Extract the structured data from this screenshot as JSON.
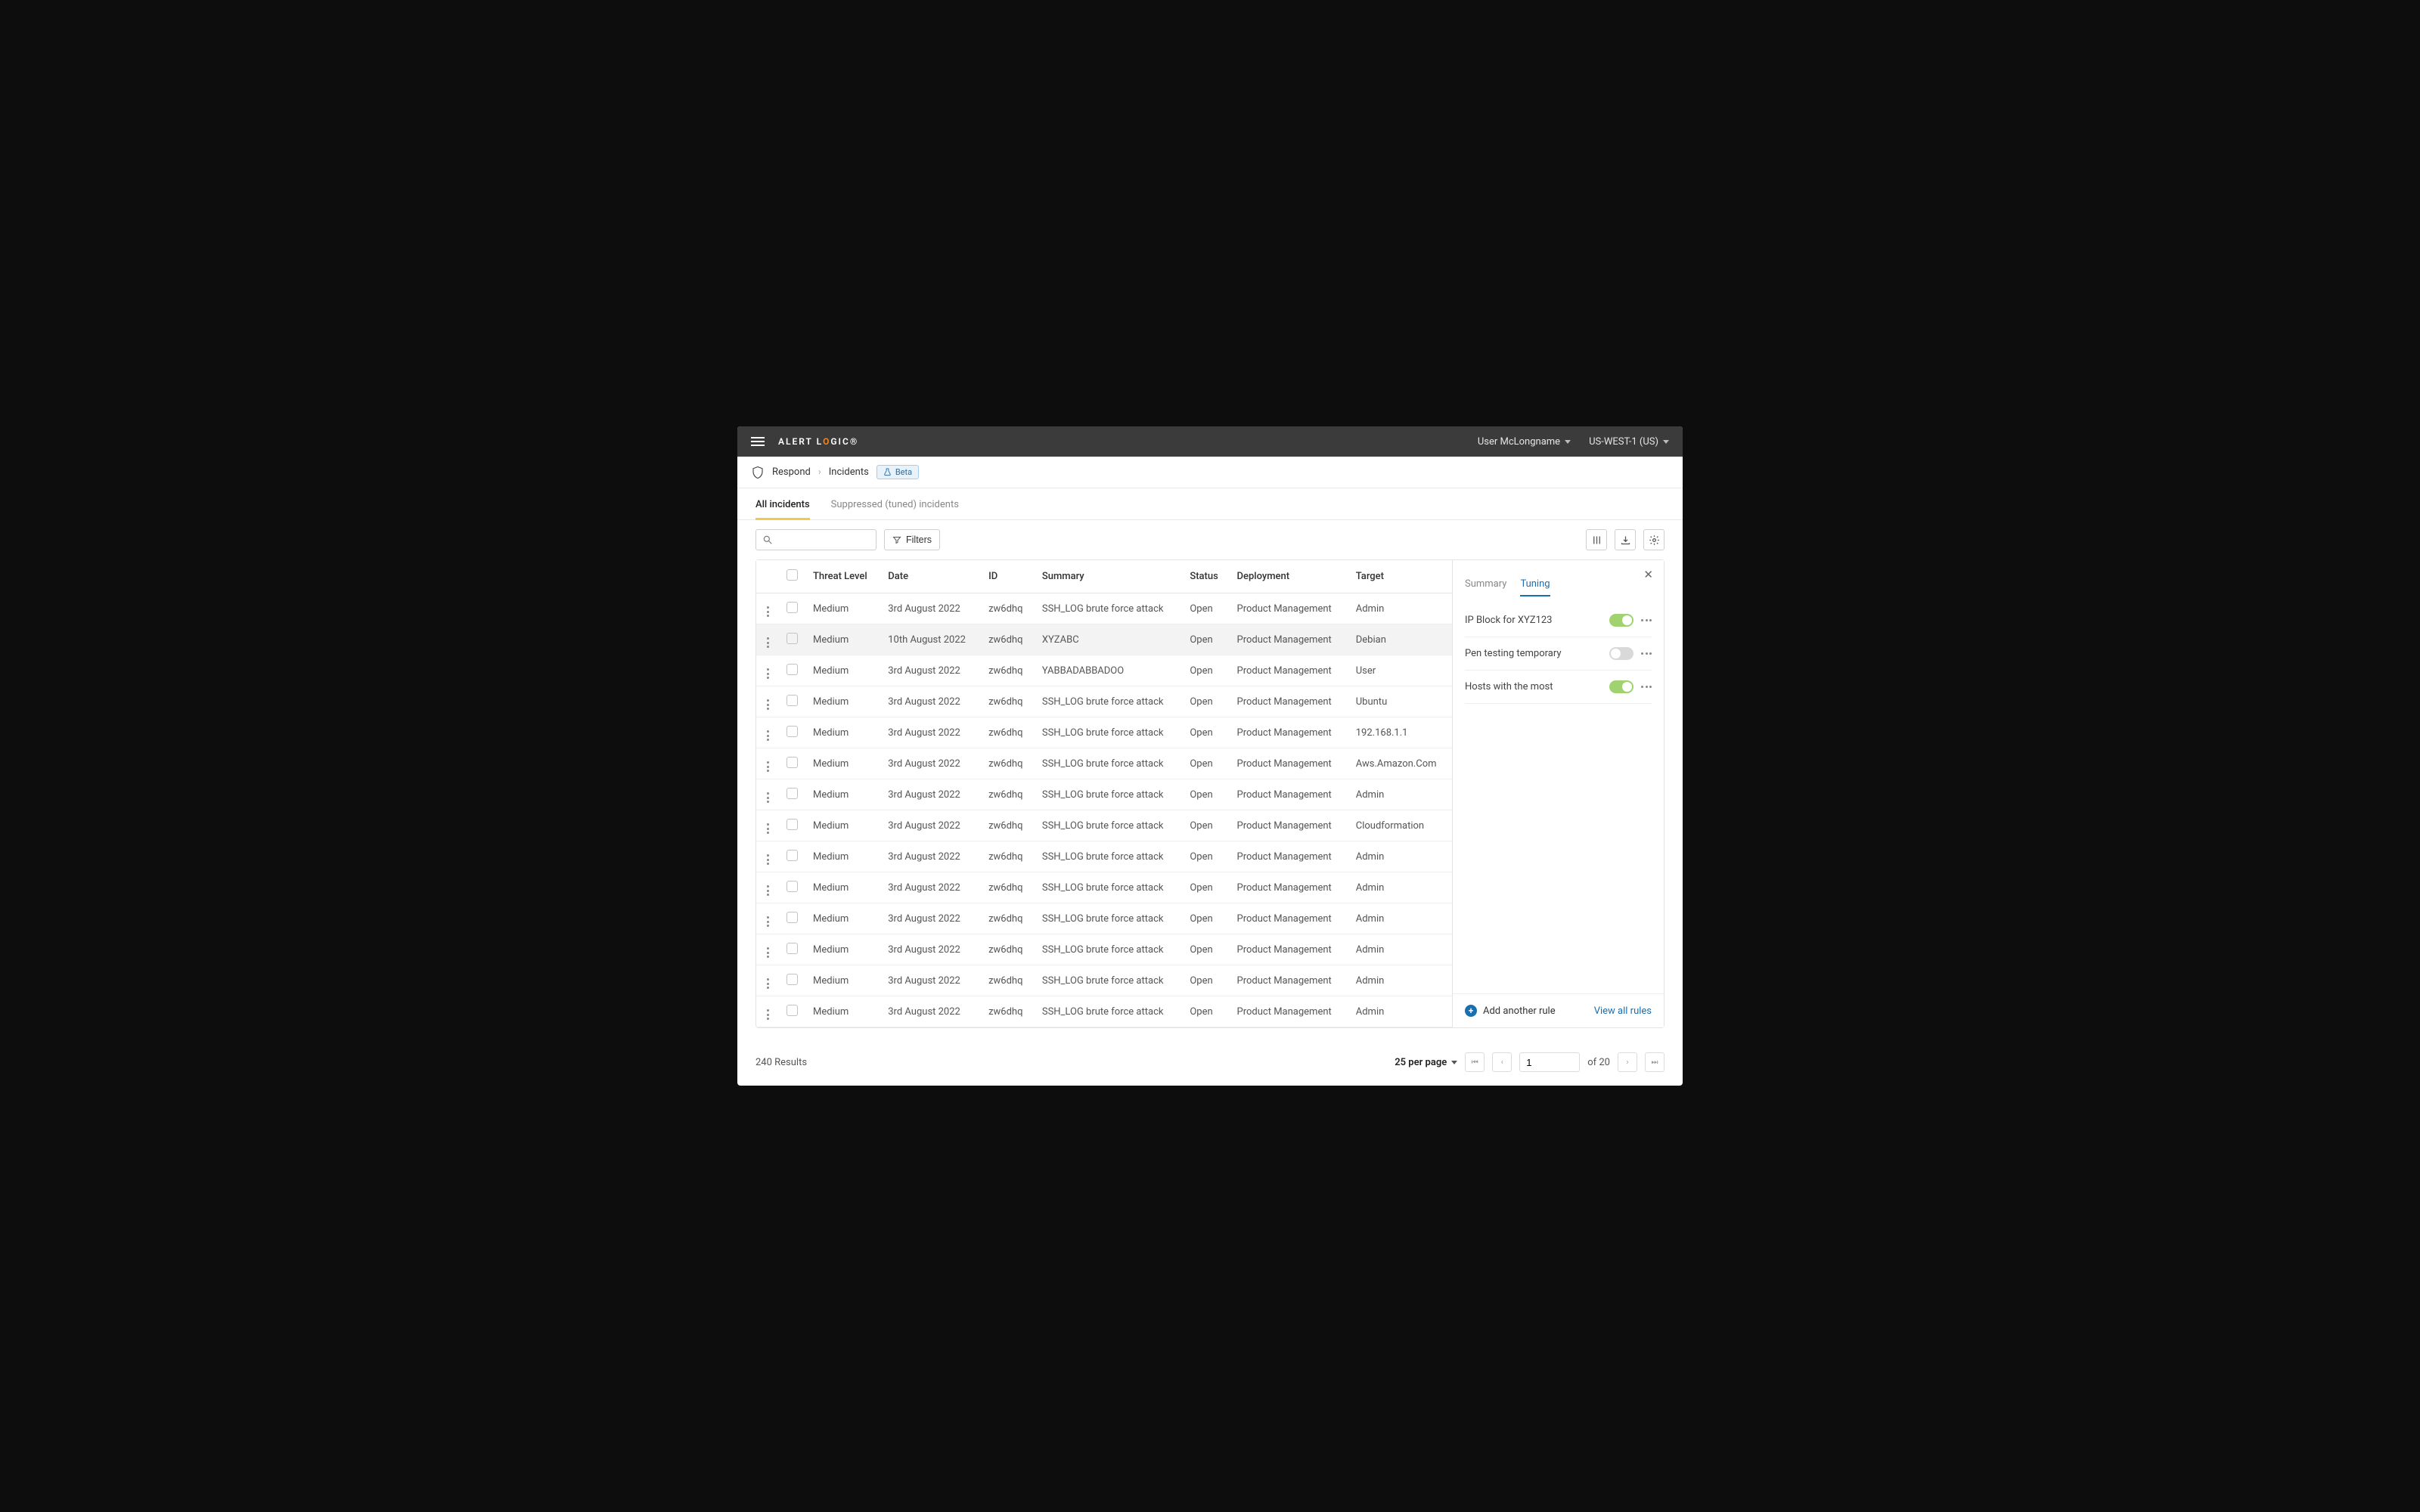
{
  "topbar": {
    "brand_prefix": "ALERT L",
    "brand_o": "O",
    "brand_suffix": "GIC®",
    "user_label": "User McLongname",
    "region_label": "US-WEST-1 (US)"
  },
  "breadcrumb": {
    "respond": "Respond",
    "incidents": "Incidents",
    "beta_label": "Beta"
  },
  "tabs": {
    "all": "All incidents",
    "suppressed": "Suppressed (tuned) incidents"
  },
  "toolbar": {
    "filters_label": "Filters"
  },
  "columns": {
    "threat": "Threat Level",
    "date": "Date",
    "id": "ID",
    "summary": "Summary",
    "status": "Status",
    "deployment": "Deployment",
    "target": "Target"
  },
  "rows": [
    {
      "threat": "Medium",
      "date": "3rd August 2022",
      "id": "zw6dhq",
      "summary": "SSH_LOG brute force attack",
      "status": "Open",
      "deployment": "Product Management",
      "target": "Admin",
      "selected": false
    },
    {
      "threat": "Medium",
      "date": "10th August 2022",
      "id": "zw6dhq",
      "summary": "XYZABC",
      "status": "Open",
      "deployment": "Product Management",
      "target": "Debian",
      "selected": true
    },
    {
      "threat": "Medium",
      "date": "3rd August 2022",
      "id": "zw6dhq",
      "summary": "YABBADABBADOO",
      "status": "Open",
      "deployment": "Product Management",
      "target": "User",
      "selected": false
    },
    {
      "threat": "Medium",
      "date": "3rd August 2022",
      "id": "zw6dhq",
      "summary": "SSH_LOG brute force attack",
      "status": "Open",
      "deployment": "Product Management",
      "target": "Ubuntu",
      "selected": false
    },
    {
      "threat": "Medium",
      "date": "3rd August 2022",
      "id": "zw6dhq",
      "summary": "SSH_LOG brute force attack",
      "status": "Open",
      "deployment": "Product Management",
      "target": "192.168.1.1",
      "selected": false
    },
    {
      "threat": "Medium",
      "date": "3rd August 2022",
      "id": "zw6dhq",
      "summary": "SSH_LOG brute force attack",
      "status": "Open",
      "deployment": "Product Management",
      "target": "Aws.Amazon.Com",
      "selected": false
    },
    {
      "threat": "Medium",
      "date": "3rd August 2022",
      "id": "zw6dhq",
      "summary": "SSH_LOG brute force attack",
      "status": "Open",
      "deployment": "Product Management",
      "target": "Admin",
      "selected": false
    },
    {
      "threat": "Medium",
      "date": "3rd August 2022",
      "id": "zw6dhq",
      "summary": "SSH_LOG brute force attack",
      "status": "Open",
      "deployment": "Product Management",
      "target": "Cloudformation",
      "selected": false
    },
    {
      "threat": "Medium",
      "date": "3rd August 2022",
      "id": "zw6dhq",
      "summary": "SSH_LOG brute force attack",
      "status": "Open",
      "deployment": "Product Management",
      "target": "Admin",
      "selected": false
    },
    {
      "threat": "Medium",
      "date": "3rd August 2022",
      "id": "zw6dhq",
      "summary": "SSH_LOG brute force attack",
      "status": "Open",
      "deployment": "Product Management",
      "target": "Admin",
      "selected": false
    },
    {
      "threat": "Medium",
      "date": "3rd August 2022",
      "id": "zw6dhq",
      "summary": "SSH_LOG brute force attack",
      "status": "Open",
      "deployment": "Product Management",
      "target": "Admin",
      "selected": false
    },
    {
      "threat": "Medium",
      "date": "3rd August 2022",
      "id": "zw6dhq",
      "summary": "SSH_LOG brute force attack",
      "status": "Open",
      "deployment": "Product Management",
      "target": "Admin",
      "selected": false
    },
    {
      "threat": "Medium",
      "date": "3rd August 2022",
      "id": "zw6dhq",
      "summary": "SSH_LOG brute force attack",
      "status": "Open",
      "deployment": "Product Management",
      "target": "Admin",
      "selected": false
    },
    {
      "threat": "Medium",
      "date": "3rd August 2022",
      "id": "zw6dhq",
      "summary": "SSH_LOG brute force attack",
      "status": "Open",
      "deployment": "Product Management",
      "target": "Admin",
      "selected": false
    }
  ],
  "side_panel": {
    "tab_summary": "Summary",
    "tab_tuning": "Tuning",
    "rules": [
      {
        "name": "IP Block for XYZ123",
        "enabled": true
      },
      {
        "name": "Pen testing temporary",
        "enabled": false
      },
      {
        "name": "Hosts with the most",
        "enabled": true
      }
    ],
    "add_rule_label": "Add another rule",
    "view_all_label": "View all rules"
  },
  "pagination": {
    "results_label": "240 Results",
    "per_page_label": "25 per page",
    "current_page": "1",
    "total_label": "of 20"
  }
}
